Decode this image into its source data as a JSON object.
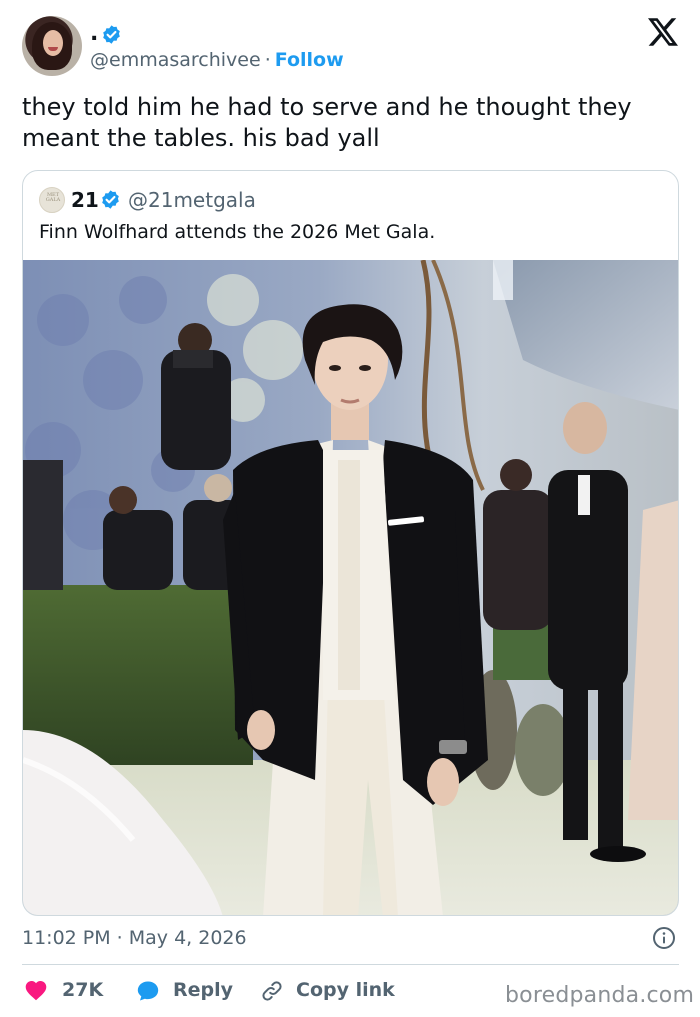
{
  "author": {
    "display_name": ".",
    "handle": "@emmasarchivee",
    "separator": "·",
    "follow_label": "Follow",
    "verified": true
  },
  "tweet": {
    "text": "they told him he had to serve and he thought they meant the tables. his bad yall"
  },
  "quoted": {
    "avatar_text": "MET GALA",
    "display_name": "21",
    "handle": "@21metgala",
    "verified": true,
    "text": "Finn Wolfhard attends the 2026 Met Gala."
  },
  "meta": {
    "timestamp": "11:02 PM · May 4, 2026"
  },
  "actions": {
    "likes": "27K",
    "reply_label": "Reply",
    "copy_label": "Copy link"
  },
  "watermark": "boredpanda.com",
  "colors": {
    "accent": "#1d9bf0",
    "like": "#f91880",
    "muted": "#536471",
    "text": "#0f1419",
    "border": "#cfd9de"
  },
  "icons": [
    "verified-badge-icon",
    "x-logo-icon",
    "info-icon",
    "heart-icon",
    "reply-bubble-icon",
    "link-icon"
  ]
}
